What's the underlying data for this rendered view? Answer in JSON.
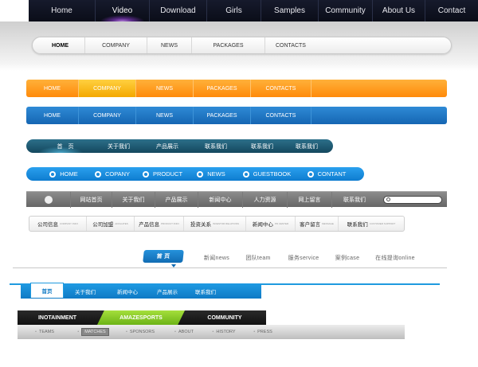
{
  "nav1": [
    "Home",
    "Video",
    "Download",
    "Girls",
    "Samples",
    "Community",
    "About Us",
    "Contact"
  ],
  "nav2": [
    "HOME",
    "COMPANY",
    "NEWS",
    "PACKAGES",
    "CONTACTS"
  ],
  "nav3": [
    "HOME",
    "COMPANY",
    "NEWS",
    "PACKAGES",
    "CONTACTS"
  ],
  "nav4": [
    "HOME",
    "COMPANY",
    "NEWS",
    "PACKAGES",
    "CONTACTS"
  ],
  "nav5": [
    "首　页",
    "关于我们",
    "产品展示",
    "联系我们",
    "联系我们",
    "联系我们"
  ],
  "nav6": [
    "HOME",
    "COPANY",
    "PRODUCT",
    "NEWS",
    "GUESTBOOK",
    "CONTANT"
  ],
  "nav7": [
    "网站首页",
    "关于我们",
    "产品展示",
    "新闻中心",
    "人力资源",
    "网上留言",
    "联系我们"
  ],
  "nav8": [
    {
      "label": "公司信息",
      "sub": "COMPANY INFO"
    },
    {
      "label": "公司加盟",
      "sub": "AFFILIATES"
    },
    {
      "label": "产品信息",
      "sub": "PRODUCT INFO"
    },
    {
      "label": "投资关系",
      "sub": "INVESTOR RELATIONS"
    },
    {
      "label": "新闻中心",
      "sub": "PR CENTER"
    },
    {
      "label": "客户留言",
      "sub": "MESSAGE"
    },
    {
      "label": "联系我们",
      "sub": "CUSTOMER SUPPORT"
    }
  ],
  "nav9": [
    "首 页",
    "新闻news",
    "团队team",
    "服务service",
    "案例case",
    "在线提询online"
  ],
  "nav10": [
    "首页",
    "关于我们",
    "新闻中心",
    "产品展示",
    "联系我们"
  ],
  "nav11": [
    "INOTAINMENT",
    "AMAZESPORTS",
    "COMMUNITY"
  ],
  "nav11_sub": [
    "TEAMS",
    "MATCHES",
    "SPONSORS",
    "ABOUT",
    "HISTORY",
    "PRESS"
  ]
}
